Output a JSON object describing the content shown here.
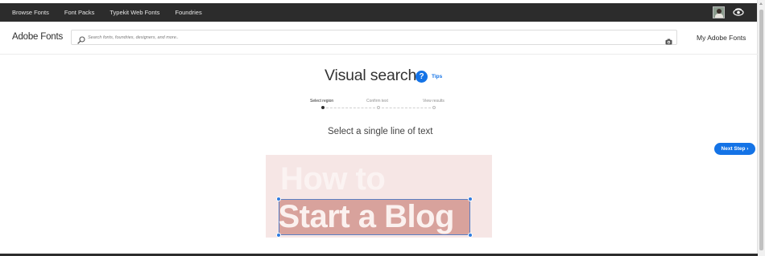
{
  "topnav": {
    "items": [
      {
        "label": "Browse Fonts"
      },
      {
        "label": "Font Packs"
      },
      {
        "label": "Typekit Web Fonts"
      },
      {
        "label": "Foundries"
      }
    ]
  },
  "header": {
    "logo": "Adobe Fonts",
    "search": {
      "placeholder": "Search fonts, foundries, designers, and more..",
      "value": ""
    },
    "my_fonts_label": "My Adobe Fonts"
  },
  "visual_search": {
    "title": "Visual search",
    "help_glyph": "?",
    "tips_label": "Tips",
    "steps": [
      {
        "label": "Select region",
        "state": "active"
      },
      {
        "label": "Confirm text",
        "state": "inactive"
      },
      {
        "label": "View results",
        "state": "inactive"
      }
    ],
    "instruction": "Select a single line of text",
    "next_button": "Next Step ›",
    "sample_image": {
      "line1": "How to",
      "line2": "Start a Blog"
    }
  },
  "icons": {
    "search": "search-icon",
    "camera": "camera-icon",
    "avatar": "avatar",
    "eye": "eye-icon",
    "help": "help-icon"
  },
  "colors": {
    "topbar": "#2c2c2c",
    "accent": "#1473e6",
    "sample_bg": "#f6e6e5",
    "selection_fill": "#d8a29c",
    "handle": "#2f7ce0"
  }
}
